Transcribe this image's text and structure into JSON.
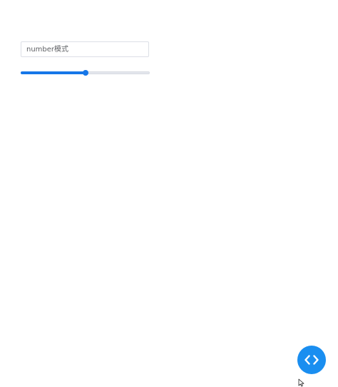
{
  "number_input": {
    "placeholder": "number模式",
    "value": ""
  },
  "slider": {
    "fraction": 0.5,
    "accent_color": "#1677e8",
    "track_color": "#e4e7ed"
  },
  "code_button": {
    "icon": "code-icon",
    "color": "#1a8ef0"
  },
  "cursor": {
    "icon": "mouse-pointer-icon"
  }
}
